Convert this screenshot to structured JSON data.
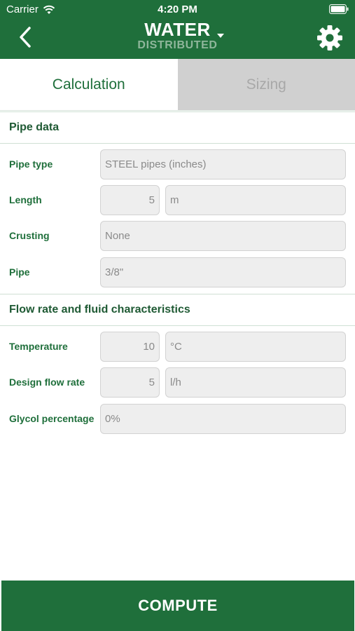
{
  "status_bar": {
    "carrier": "Carrier",
    "time": "4:20 PM"
  },
  "header": {
    "title": "WATER",
    "subtitle": "DISTRIBUTED",
    "back_icon": "chevron-left-icon",
    "settings_icon": "gear-icon",
    "background": "#1f6f3b"
  },
  "tabs": [
    {
      "label": "Calculation",
      "active": true
    },
    {
      "label": "Sizing",
      "active": false
    }
  ],
  "sections": {
    "pipe_data": {
      "title": "Pipe data",
      "pipe_type": {
        "label": "Pipe type",
        "value": "STEEL pipes (inches)"
      },
      "length": {
        "label": "Length",
        "value": "5",
        "unit": "m"
      },
      "crusting": {
        "label": "Crusting",
        "value": "None"
      },
      "pipe": {
        "label": "Pipe",
        "value": "3/8\""
      }
    },
    "flow": {
      "title": "Flow rate and fluid characteristics",
      "temperature": {
        "label": "Temperature",
        "value": "10",
        "unit": "°C"
      },
      "design_flow_rate": {
        "label": "Design flow rate",
        "value": "5",
        "unit": "l/h"
      },
      "glycol": {
        "label": "Glycol percentage",
        "value": "0%"
      }
    }
  },
  "compute_label": "COMPUTE"
}
